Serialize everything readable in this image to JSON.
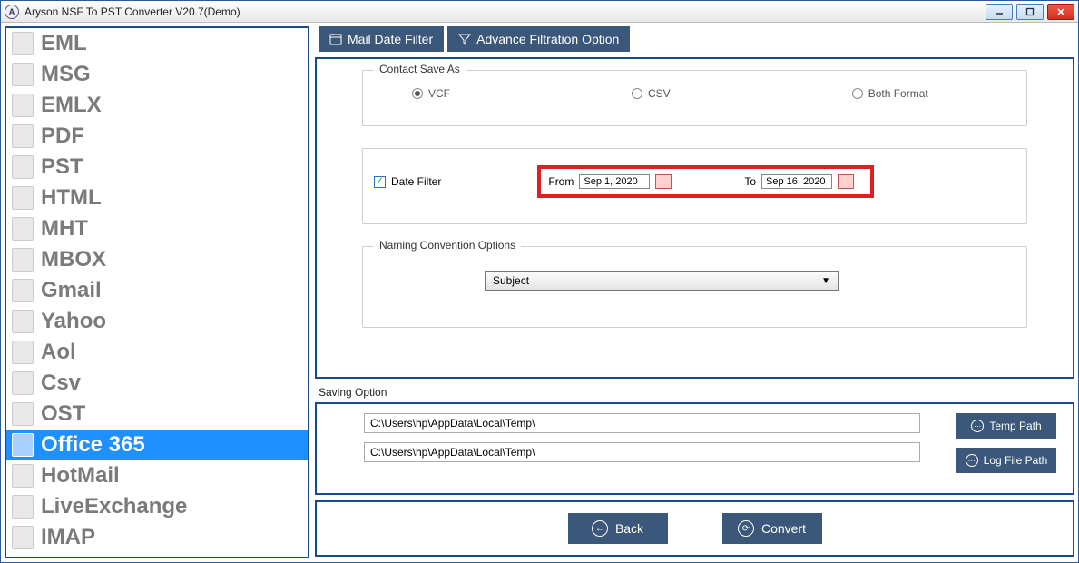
{
  "window": {
    "title": "Aryson NSF To PST Converter V20.7(Demo)"
  },
  "sidebar": {
    "items": [
      {
        "label": "EML"
      },
      {
        "label": "MSG"
      },
      {
        "label": "EMLX"
      },
      {
        "label": "PDF"
      },
      {
        "label": "PST"
      },
      {
        "label": "HTML"
      },
      {
        "label": "MHT"
      },
      {
        "label": "MBOX"
      },
      {
        "label": "Gmail"
      },
      {
        "label": "Yahoo"
      },
      {
        "label": "Aol"
      },
      {
        "label": "Csv"
      },
      {
        "label": "OST"
      },
      {
        "label": "Office 365"
      },
      {
        "label": "HotMail"
      },
      {
        "label": "LiveExchange"
      },
      {
        "label": "IMAP"
      }
    ],
    "selected_index": 13
  },
  "tabs": {
    "mail_date_filter": "Mail Date Filter",
    "advance_filtration": "Advance Filtration Option"
  },
  "contact_save_as": {
    "legend": "Contact Save As",
    "options": {
      "vcf": "VCF",
      "csv": "CSV",
      "both": "Both Format"
    },
    "selected": "vcf"
  },
  "date_filter": {
    "checkbox_label": "Date Filter",
    "checked": true,
    "from_label": "From",
    "from_value": "Sep 1, 2020",
    "to_label": "To",
    "to_value": "Sep 16, 2020"
  },
  "naming": {
    "legend": "Naming Convention Options",
    "selected": "Subject"
  },
  "saving": {
    "title": "Saving Option",
    "path1": "C:\\Users\\hp\\AppData\\Local\\Temp\\",
    "path2": "C:\\Users\\hp\\AppData\\Local\\Temp\\",
    "temp_btn": "Temp Path",
    "log_btn": "Log File Path"
  },
  "footer": {
    "back": "Back",
    "convert": "Convert"
  }
}
